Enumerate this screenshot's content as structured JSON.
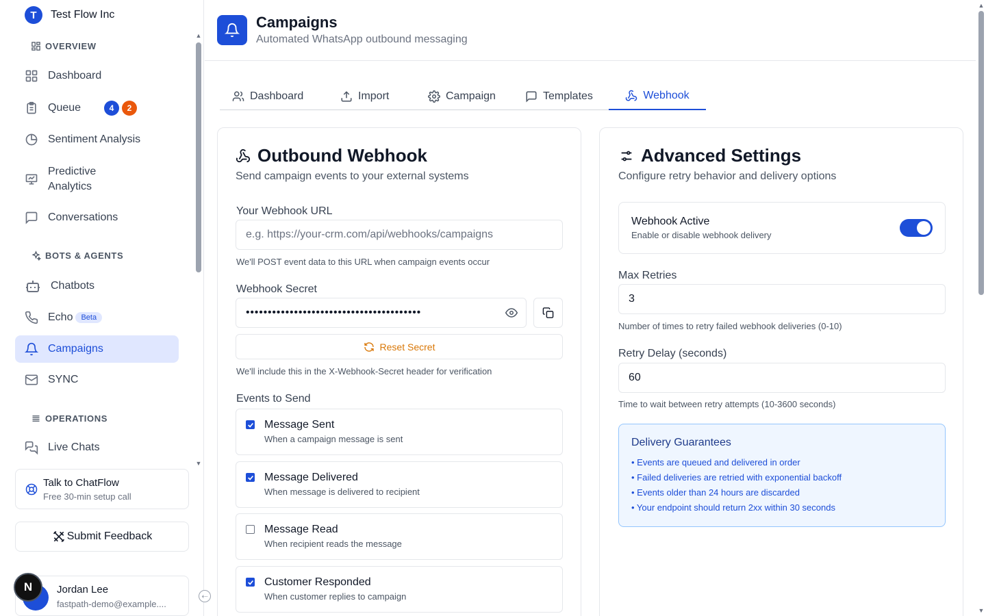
{
  "org": {
    "initial": "T",
    "name": "Test Flow Inc"
  },
  "sidebar": {
    "sections": {
      "overview": "OVERVIEW",
      "bots": "BOTS & AGENTS",
      "operations": "OPERATIONS"
    },
    "items": {
      "dashboard": "Dashboard",
      "queue": "Queue",
      "queue_badge_blue": "4",
      "queue_badge_orange": "2",
      "sentiment": "Sentiment Analysis",
      "predictive_line1": "Predictive",
      "predictive_line2": "Analytics",
      "conversations": "Conversations",
      "chatbots": "Chatbots",
      "echo": "Echo",
      "echo_badge": "Beta",
      "campaigns": "Campaigns",
      "sync": "SYNC",
      "live_chats": "Live Chats"
    },
    "talk": {
      "title": "Talk to ChatFlow",
      "subtitle": "Free 30-min setup call"
    },
    "feedback": "Submit Feedback",
    "user": {
      "name": "Jordan Lee",
      "email": "fastpath-demo@example...."
    },
    "n_badge": "N"
  },
  "header": {
    "title": "Campaigns",
    "subtitle": "Automated WhatsApp outbound messaging"
  },
  "tabs": {
    "dashboard": "Dashboard",
    "import": "Import",
    "campaign": "Campaign",
    "templates": "Templates",
    "webhook": "Webhook"
  },
  "webhook": {
    "title": "Outbound Webhook",
    "subtitle": "Send campaign events to your external systems",
    "url_label": "Your Webhook URL",
    "url_placeholder": "e.g. https://your-crm.com/api/webhooks/campaigns",
    "url_hint": "We'll POST event data to this URL when campaign events occur",
    "secret_label": "Webhook Secret",
    "secret_value": "••••••••••••••••••••••••••••••••••••••••",
    "reset_label": "Reset Secret",
    "secret_hint": "We'll include this in the X-Webhook-Secret header for verification",
    "events_label": "Events to Send",
    "events": [
      {
        "title": "Message Sent",
        "desc": "When a campaign message is sent",
        "checked": true
      },
      {
        "title": "Message Delivered",
        "desc": "When message is delivered to recipient",
        "checked": true
      },
      {
        "title": "Message Read",
        "desc": "When recipient reads the message",
        "checked": false
      },
      {
        "title": "Customer Responded",
        "desc": "When customer replies to campaign",
        "checked": true
      }
    ]
  },
  "advanced": {
    "title": "Advanced Settings",
    "subtitle": "Configure retry behavior and delivery options",
    "active_title": "Webhook Active",
    "active_sub": "Enable or disable webhook delivery",
    "active_on": true,
    "retries_label": "Max Retries",
    "retries_value": "3",
    "retries_hint": "Number of times to retry failed webhook deliveries (0-10)",
    "delay_label": "Retry Delay (seconds)",
    "delay_value": "60",
    "delay_hint": "Time to wait between retry attempts (10-3600 seconds)",
    "guarantee_title": "Delivery Guarantees",
    "guarantees": [
      "• Events are queued and delivered in order",
      "• Failed deliveries are retried with exponential backoff",
      "• Events older than 24 hours are discarded",
      "• Your endpoint should return 2xx within 30 seconds"
    ]
  },
  "colors": {
    "primary": "#1d4ed8",
    "accent_orange": "#ea580c",
    "warning": "#d97706",
    "active_bg": "#e0e7ff"
  }
}
